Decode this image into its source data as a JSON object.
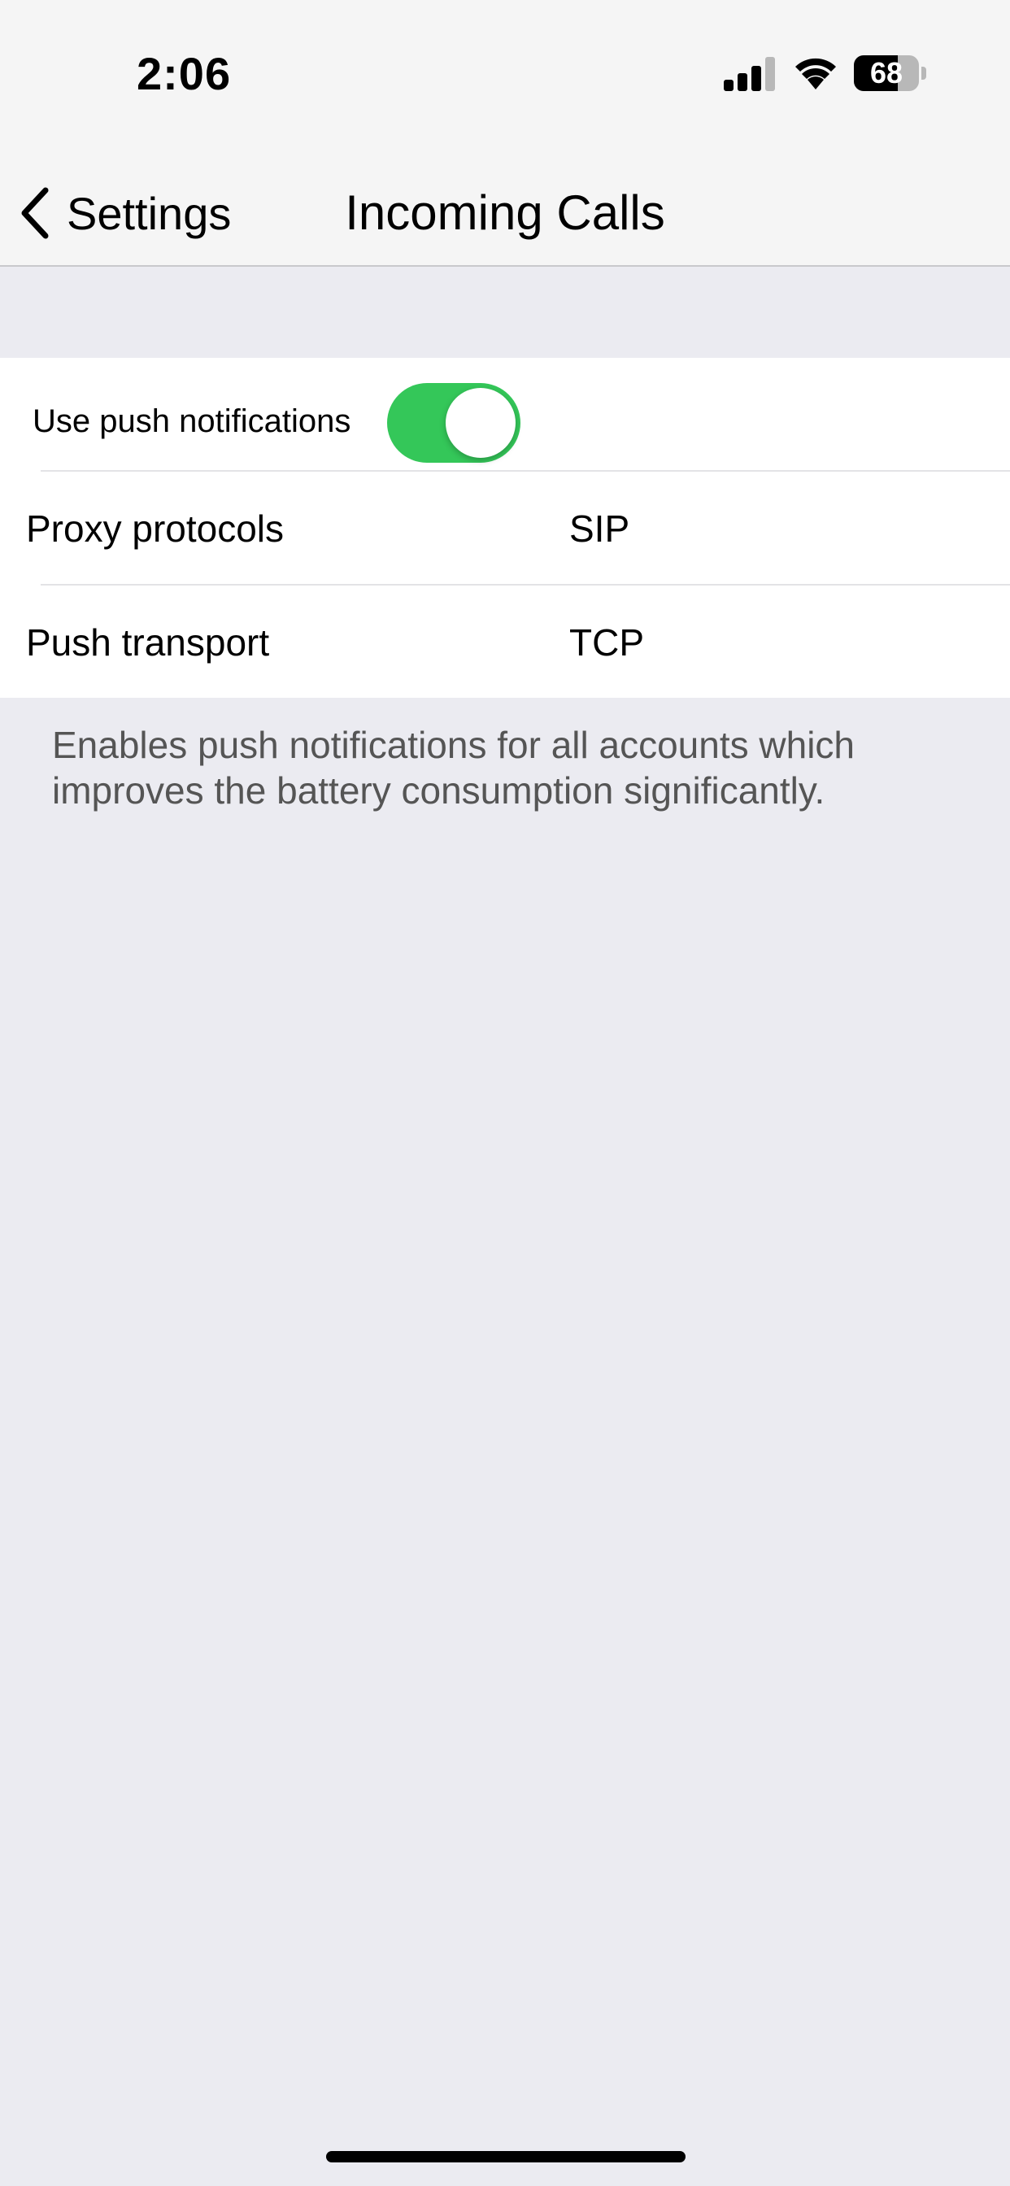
{
  "status_bar": {
    "time": "2:06",
    "battery_level": "68",
    "battery_fraction": 0.68,
    "icons": [
      "cellular-signal-icon",
      "wifi-icon",
      "battery-icon"
    ]
  },
  "nav": {
    "back_label": "Settings",
    "back_icon": "chevron-left-icon",
    "title": "Incoming Calls"
  },
  "settings": {
    "push_notifications_label": "Use push notifications",
    "push_notifications_on": true,
    "proxy_protocols_label": "Proxy protocols",
    "proxy_protocols_value": "SIP",
    "push_transport_label": "Push transport",
    "push_transport_value": "TCP"
  },
  "footer": {
    "text": "Enables push notifications for all accounts which improves the battery consumption significantly."
  },
  "colors": {
    "toggle_on": "#34c759",
    "group_background": "#ebebf1",
    "bar_background": "#f5f5f5"
  }
}
